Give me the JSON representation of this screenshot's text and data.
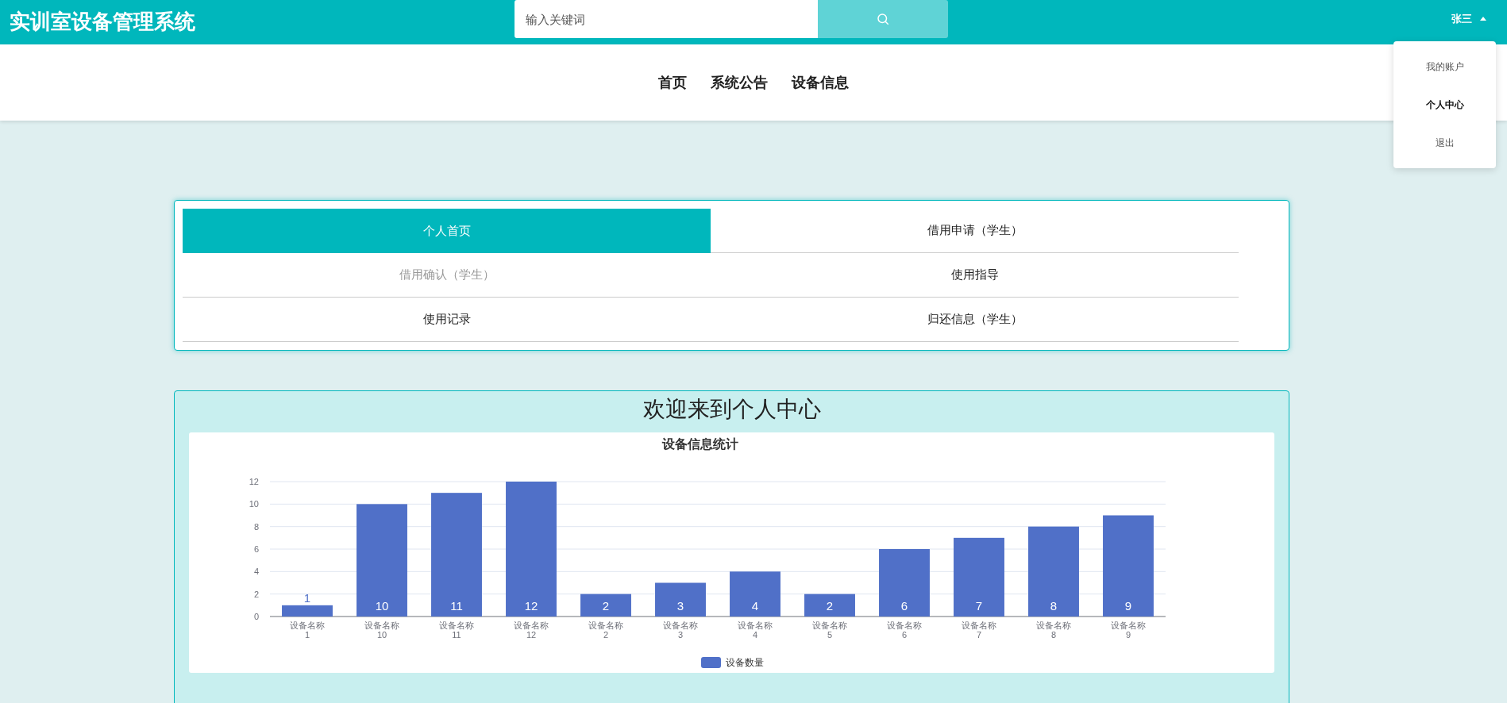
{
  "header": {
    "title": "实训室设备管理系统",
    "search": {
      "placeholder": "输入关键词"
    },
    "user": "张三"
  },
  "user_menu": [
    {
      "label": "我的账户",
      "selected": false
    },
    {
      "label": "个人中心",
      "selected": true
    },
    {
      "label": "退出",
      "selected": false
    }
  ],
  "nav": [
    {
      "label": "首页"
    },
    {
      "label": "系统公告"
    },
    {
      "label": "设备信息"
    }
  ],
  "tabs": [
    {
      "label": "个人首页",
      "selected": true,
      "hovered": false
    },
    {
      "label": "借用申请（学生）",
      "selected": false,
      "hovered": false
    },
    {
      "label": "借用确认（学生）",
      "selected": false,
      "hovered": true
    },
    {
      "label": "使用指导",
      "selected": false,
      "hovered": false
    },
    {
      "label": "使用记录",
      "selected": false,
      "hovered": false
    },
    {
      "label": "归还信息（学生）",
      "selected": false,
      "hovered": false
    }
  ],
  "welcome": "欢迎来到个人中心",
  "chart_data": {
    "type": "bar",
    "title": "设备信息统计",
    "categories": [
      "设备名称\n1",
      "设备名称\n10",
      "设备名称\n11",
      "设备名称\n12",
      "设备名称\n2",
      "设备名称\n3",
      "设备名称\n4",
      "设备名称\n5",
      "设备名称\n6",
      "设备名称\n7",
      "设备名称\n8",
      "设备名称\n9"
    ],
    "series": [
      {
        "name": "设备数量",
        "color": "#5070c8",
        "values": [
          1,
          10,
          11,
          12,
          2,
          3,
          4,
          2,
          6,
          7,
          8,
          9
        ]
      }
    ],
    "ylim": [
      0,
      12
    ],
    "grid": true,
    "yticks": [
      0,
      2,
      4,
      6,
      8,
      10,
      12
    ],
    "data_labels": true
  }
}
